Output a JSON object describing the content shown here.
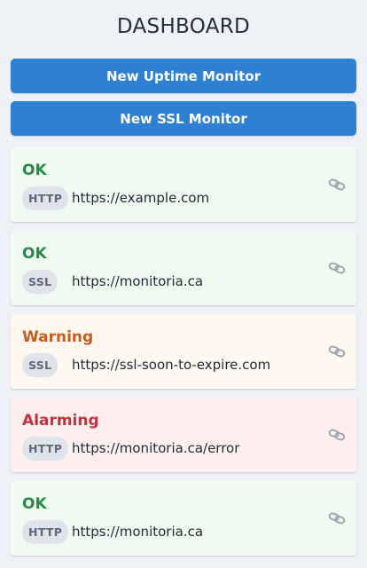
{
  "header": {
    "title": "DASHBOARD"
  },
  "actions": {
    "new_uptime_label": "New Uptime Monitor",
    "new_ssl_label": "New SSL Monitor"
  },
  "monitors": [
    {
      "status": "OK",
      "state": "ok",
      "type": "HTTP",
      "url": "https://example.com",
      "icon": "link-icon"
    },
    {
      "status": "OK",
      "state": "ok",
      "type": "SSL",
      "url": "https://monitoria.ca",
      "icon": "link-icon"
    },
    {
      "status": "Warning",
      "state": "warning",
      "type": "SSL",
      "url": "https://ssl-soon-to-expire.com",
      "icon": "link-icon"
    },
    {
      "status": "Alarming",
      "state": "alarming",
      "type": "HTTP",
      "url": "https://monitoria.ca/error",
      "icon": "link-icon"
    },
    {
      "status": "OK",
      "state": "ok",
      "type": "HTTP",
      "url": "https://monitoria.ca",
      "icon": "link-icon"
    }
  ],
  "colors": {
    "background": "#eef2f7",
    "button": "#2f7fd3",
    "ok": "#2b8a4a",
    "warning": "#c65c1f",
    "alarming": "#c6303a"
  }
}
